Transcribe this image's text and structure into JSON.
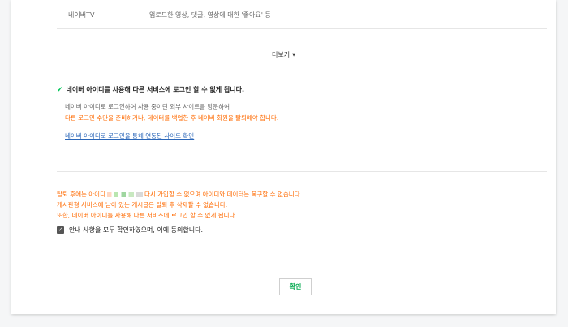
{
  "service_table": {
    "row": {
      "name": "네이버TV",
      "description": "업로드한 영상, 댓글, 영상에 대한 '좋아요' 등"
    }
  },
  "more_button": {
    "label": "더보기",
    "icon": "caret-down-icon"
  },
  "id_notice": {
    "title": "네이버 아이디를 사용해 다른 서비스에 로그인 할 수 없게 됩니다.",
    "line1": "네이버 아이디로 로그인하여 사용 중이던 외부 사이트를 방문하여",
    "line2": "다른 로그인 수단을 준비하거나, 데이터를 백업한 후 네이버 회원을 탈퇴해야 합니다.",
    "link_label": "네이버 아이디로 로그인을 통해 연동된 사이트 확인"
  },
  "warning": {
    "line1_prefix": "탈퇴 후에는 아이디",
    "line1_suffix": "다시 가입할 수 없으며 아이디와 데이터는 복구할 수 없습니다.",
    "line2": "게시판형 서비스에 남아 있는 게시글은 탈퇴 후 삭제할 수 없습니다.",
    "line3": "또한, 네이버 아이디를 사용해 다른 서비스에 로그인 할 수 없게 됩니다."
  },
  "agreement": {
    "label": "안내 사항을 모두 확인하였으며, 이에 동의합니다.",
    "checked": true
  },
  "confirm_button": {
    "label": "확인"
  },
  "colors": {
    "accent_green": "#03c75a",
    "warning_orange": "#ff6a00",
    "link_blue": "#2a66b8"
  }
}
